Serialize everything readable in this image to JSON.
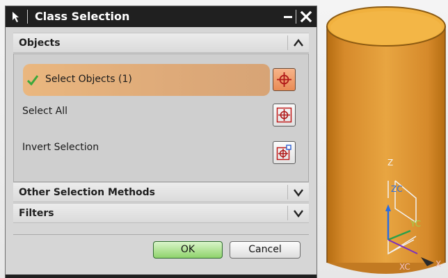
{
  "dialog": {
    "title": "Class Selection",
    "sections": {
      "objects": "Objects",
      "other_methods": "Other Selection Methods",
      "filters": "Filters"
    },
    "rows": {
      "select_objects": "Select Objects (1)",
      "select_all": "Select All",
      "invert_selection": "Invert Selection"
    },
    "buttons": {
      "ok": "OK",
      "cancel": "Cancel"
    }
  },
  "viewport": {
    "axis_labels": {
      "z": "Z",
      "zc": "ZC",
      "yc": "YC",
      "xc": "XC",
      "x": "X"
    },
    "cylinder_color": "#e09a34"
  },
  "icons": [
    "pointer-arrow-icon",
    "minimize-icon",
    "close-icon",
    "chevron-up-icon",
    "chevron-down-icon",
    "checkmark-icon",
    "crosshair-icon"
  ]
}
